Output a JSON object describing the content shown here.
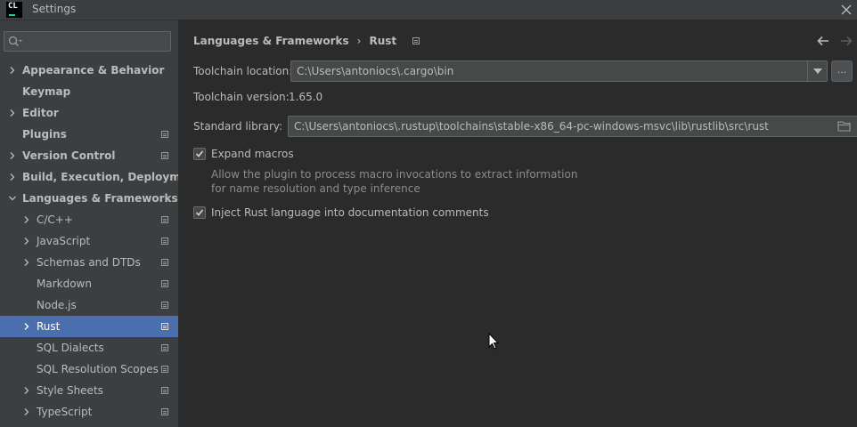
{
  "window": {
    "app_logo": "CL",
    "title": "Settings"
  },
  "sidebar": {
    "search_placeholder": "",
    "items": [
      {
        "label": "Appearance & Behavior",
        "bold": true,
        "level": 0,
        "expandable": true,
        "expanded": false,
        "project": false
      },
      {
        "label": "Keymap",
        "bold": true,
        "level": 0,
        "expandable": false,
        "project": false
      },
      {
        "label": "Editor",
        "bold": true,
        "level": 0,
        "expandable": true,
        "expanded": false,
        "project": false
      },
      {
        "label": "Plugins",
        "bold": true,
        "level": 0,
        "expandable": false,
        "project": true
      },
      {
        "label": "Version Control",
        "bold": true,
        "level": 0,
        "expandable": true,
        "expanded": false,
        "project": true
      },
      {
        "label": "Build, Execution, Deployment",
        "bold": true,
        "level": 0,
        "expandable": true,
        "expanded": false,
        "project": false
      },
      {
        "label": "Languages & Frameworks",
        "bold": true,
        "level": 0,
        "expandable": true,
        "expanded": true,
        "project": false
      },
      {
        "label": "C/C++",
        "bold": false,
        "level": 1,
        "expandable": true,
        "expanded": false,
        "project": true
      },
      {
        "label": "JavaScript",
        "bold": false,
        "level": 1,
        "expandable": true,
        "expanded": false,
        "project": true
      },
      {
        "label": "Schemas and DTDs",
        "bold": false,
        "level": 1,
        "expandable": true,
        "expanded": false,
        "project": true
      },
      {
        "label": "Markdown",
        "bold": false,
        "level": 1,
        "expandable": false,
        "project": true
      },
      {
        "label": "Node.js",
        "bold": false,
        "level": 1,
        "expandable": false,
        "project": true
      },
      {
        "label": "Rust",
        "bold": false,
        "level": 1,
        "expandable": true,
        "expanded": false,
        "project": true,
        "selected": true
      },
      {
        "label": "SQL Dialects",
        "bold": false,
        "level": 1,
        "expandable": false,
        "project": true
      },
      {
        "label": "SQL Resolution Scopes",
        "bold": false,
        "level": 1,
        "expandable": false,
        "project": true
      },
      {
        "label": "Style Sheets",
        "bold": false,
        "level": 1,
        "expandable": true,
        "expanded": false,
        "project": true
      },
      {
        "label": "TypeScript",
        "bold": false,
        "level": 1,
        "expandable": true,
        "expanded": false,
        "project": true
      }
    ]
  },
  "content": {
    "breadcrumb": [
      "Languages & Frameworks",
      "Rust"
    ],
    "breadcrumb_sep": "›",
    "toolchain_location_label": "Toolchain location:",
    "toolchain_location_value": "C:\\Users\\antoniocs\\.cargo\\bin",
    "browse_label": "...",
    "toolchain_version_label": "Toolchain version:",
    "toolchain_version_value": "1.65.0",
    "standard_library_label": "Standard library:",
    "standard_library_value": "C:\\Users\\antoniocs\\.rustup\\toolchains\\stable-x86_64-pc-windows-msvc\\lib\\rustlib\\src\\rust",
    "expand_macros_label": "Expand macros",
    "expand_macros_checked": true,
    "expand_macros_hint_line1": "Allow the plugin to process macro invocations to extract information",
    "expand_macros_hint_line2": "for name resolution and type inference",
    "inject_rust_label": "Inject Rust language into documentation comments",
    "inject_rust_checked": true
  },
  "colors": {
    "accent_selection": "#4b6eaf",
    "panel_bg": "#3c3f41",
    "content_bg": "#2b2b2b",
    "text": "#bbbbbb",
    "hint_text": "#8c8c8c"
  }
}
